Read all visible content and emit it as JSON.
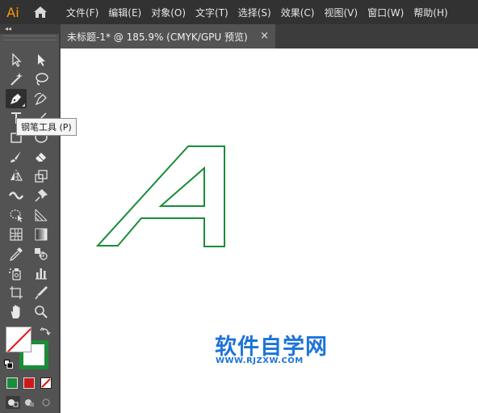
{
  "app": {
    "logo_text": "Ai",
    "brand_color": "#ff9a00"
  },
  "menu": [
    "文件(F)",
    "编辑(E)",
    "对象(O)",
    "文字(T)",
    "选择(S)",
    "效果(C)",
    "视图(V)",
    "窗口(W)",
    "帮助(H)"
  ],
  "document_tab": {
    "title": "未标题-1* @ 185.9% (CMYK/GPU 预览)",
    "close": "×"
  },
  "toolbar": {
    "collapse_glyph": "◂◂",
    "tools": [
      "selection-tool",
      "direct-selection-tool",
      "magic-wand-tool",
      "lasso-tool",
      "pen-tool",
      "curvature-tool",
      "type-tool",
      "line-segment-tool",
      "rectangle-tool",
      "ellipse-tool",
      "paintbrush-tool",
      "eraser-tool",
      "reflect-tool",
      "scale-tool",
      "width-tool",
      "puppet-warp-tool",
      "free-transform-tool",
      "perspective-grid-tool",
      "mesh-tool",
      "gradient-tool",
      "eyedropper-tool",
      "blend-tool",
      "symbol-sprayer-tool",
      "column-graph-tool",
      "artboard-tool",
      "slice-tool",
      "hand-tool",
      "zoom-tool"
    ],
    "active_tool": "pen-tool"
  },
  "tooltip": {
    "text": "钢笔工具 (P)"
  },
  "colors": {
    "fill": "none",
    "stroke": "#1a8c3a",
    "mode_color": "#1a8c3a",
    "mode_gradient": "#cc1a1a"
  },
  "artwork": {
    "glyph": "A",
    "stroke_color": "#1a8c3a"
  },
  "watermark": {
    "title": "软件自学网",
    "url": "WWW.RJZXW.COM",
    "color": "#1e73d8"
  }
}
